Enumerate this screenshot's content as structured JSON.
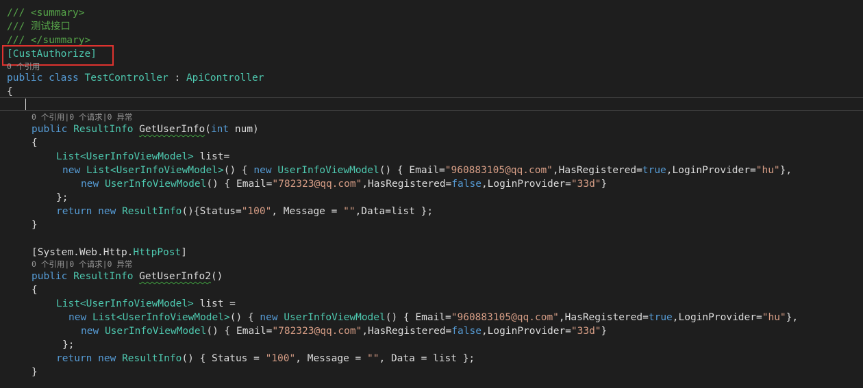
{
  "accent": {
    "highlight_box": "#e0332f",
    "keyword": "#569cd6",
    "type": "#4ec9b0",
    "string": "#d69d85",
    "comment": "#57a64a"
  },
  "code": {
    "summary_open": "/// <summary>",
    "summary_text": "/// 测试接口",
    "summary_close": "/// </summary>",
    "attribute": "[CustAuthorize]",
    "class_refs": "0 个引用",
    "class_decl": {
      "public": "public",
      "class": "class",
      "name": "TestController",
      "colon": " : ",
      "base": "ApiController"
    },
    "open_brace": "{",
    "method1": {
      "codelens": "0 个引用|0 个请求|0 异常",
      "public": "public",
      "return_type": "ResultInfo",
      "name": "GetUserInfo",
      "paren_open": "(",
      "param_type": "int",
      "param_name": " num)",
      "brace_open": "{",
      "l1_type": "List<UserInfoViewModel>",
      "l1_rest": " list=",
      "l2_new1": "new",
      "l2_type1": "List<UserInfoViewModel>",
      "l2_mid1": "() { ",
      "l2_new2": "new",
      "l2_type2": "UserInfoViewModel",
      "l2_mid2": "() { Email=",
      "l2_email": "\"960883105@qq.com\"",
      "l2_mid3": ",HasRegistered=",
      "l2_bool": "true",
      "l2_mid4": ",LoginProvider=",
      "l2_prov": "\"hu\"",
      "l2_end": "},",
      "l3_new": "new",
      "l3_type": "UserInfoViewModel",
      "l3_mid1": "() { Email=",
      "l3_email": "\"782323@qq.com\"",
      "l3_mid2": ",HasRegistered=",
      "l3_bool": "false",
      "l3_mid3": ",LoginProvider=",
      "l3_prov": "\"33d\"",
      "l3_end": "}",
      "l4": "};",
      "ret_kw": "return",
      "ret_new": "new",
      "ret_type": "ResultInfo",
      "ret_mid1": "(){Status=",
      "ret_status": "\"100\"",
      "ret_mid2": ", Message = ",
      "ret_msg": "\"\"",
      "ret_end": ",Data=list };",
      "brace_close": "}"
    },
    "method2": {
      "attr_open": "[System.Web.Http.",
      "attr_type": "HttpPost",
      "attr_close": "]",
      "codelens": "0 个引用|0 个请求|0 异常",
      "public": "public",
      "return_type": "ResultInfo",
      "name": "GetUserInfo2",
      "parens": "()",
      "brace_open": "{",
      "l1_type": "List<UserInfoViewModel>",
      "l1_rest": " list =",
      "l2_new1": "new",
      "l2_type1": "List<UserInfoViewModel>",
      "l2_mid1": "() { ",
      "l2_new2": "new",
      "l2_type2": "UserInfoViewModel",
      "l2_mid2": "() { Email=",
      "l2_email": "\"960883105@qq.com\"",
      "l2_mid3": ",HasRegistered=",
      "l2_bool": "true",
      "l2_mid4": ",LoginProvider=",
      "l2_prov": "\"hu\"",
      "l2_end": "},",
      "l3_new": "new",
      "l3_type": "UserInfoViewModel",
      "l3_mid1": "() { Email=",
      "l3_email": "\"782323@qq.com\"",
      "l3_mid2": ",HasRegistered=",
      "l3_bool": "false",
      "l3_mid3": ",LoginProvider=",
      "l3_prov": "\"33d\"",
      "l3_end": "}",
      "l4": "};",
      "ret_kw": "return",
      "ret_new": "new",
      "ret_type": "ResultInfo",
      "ret_mid1": "() { Status = ",
      "ret_status": "\"100\"",
      "ret_mid2": ", Message = ",
      "ret_msg": "\"\"",
      "ret_end": ", Data = list };",
      "brace_close": "}"
    }
  }
}
